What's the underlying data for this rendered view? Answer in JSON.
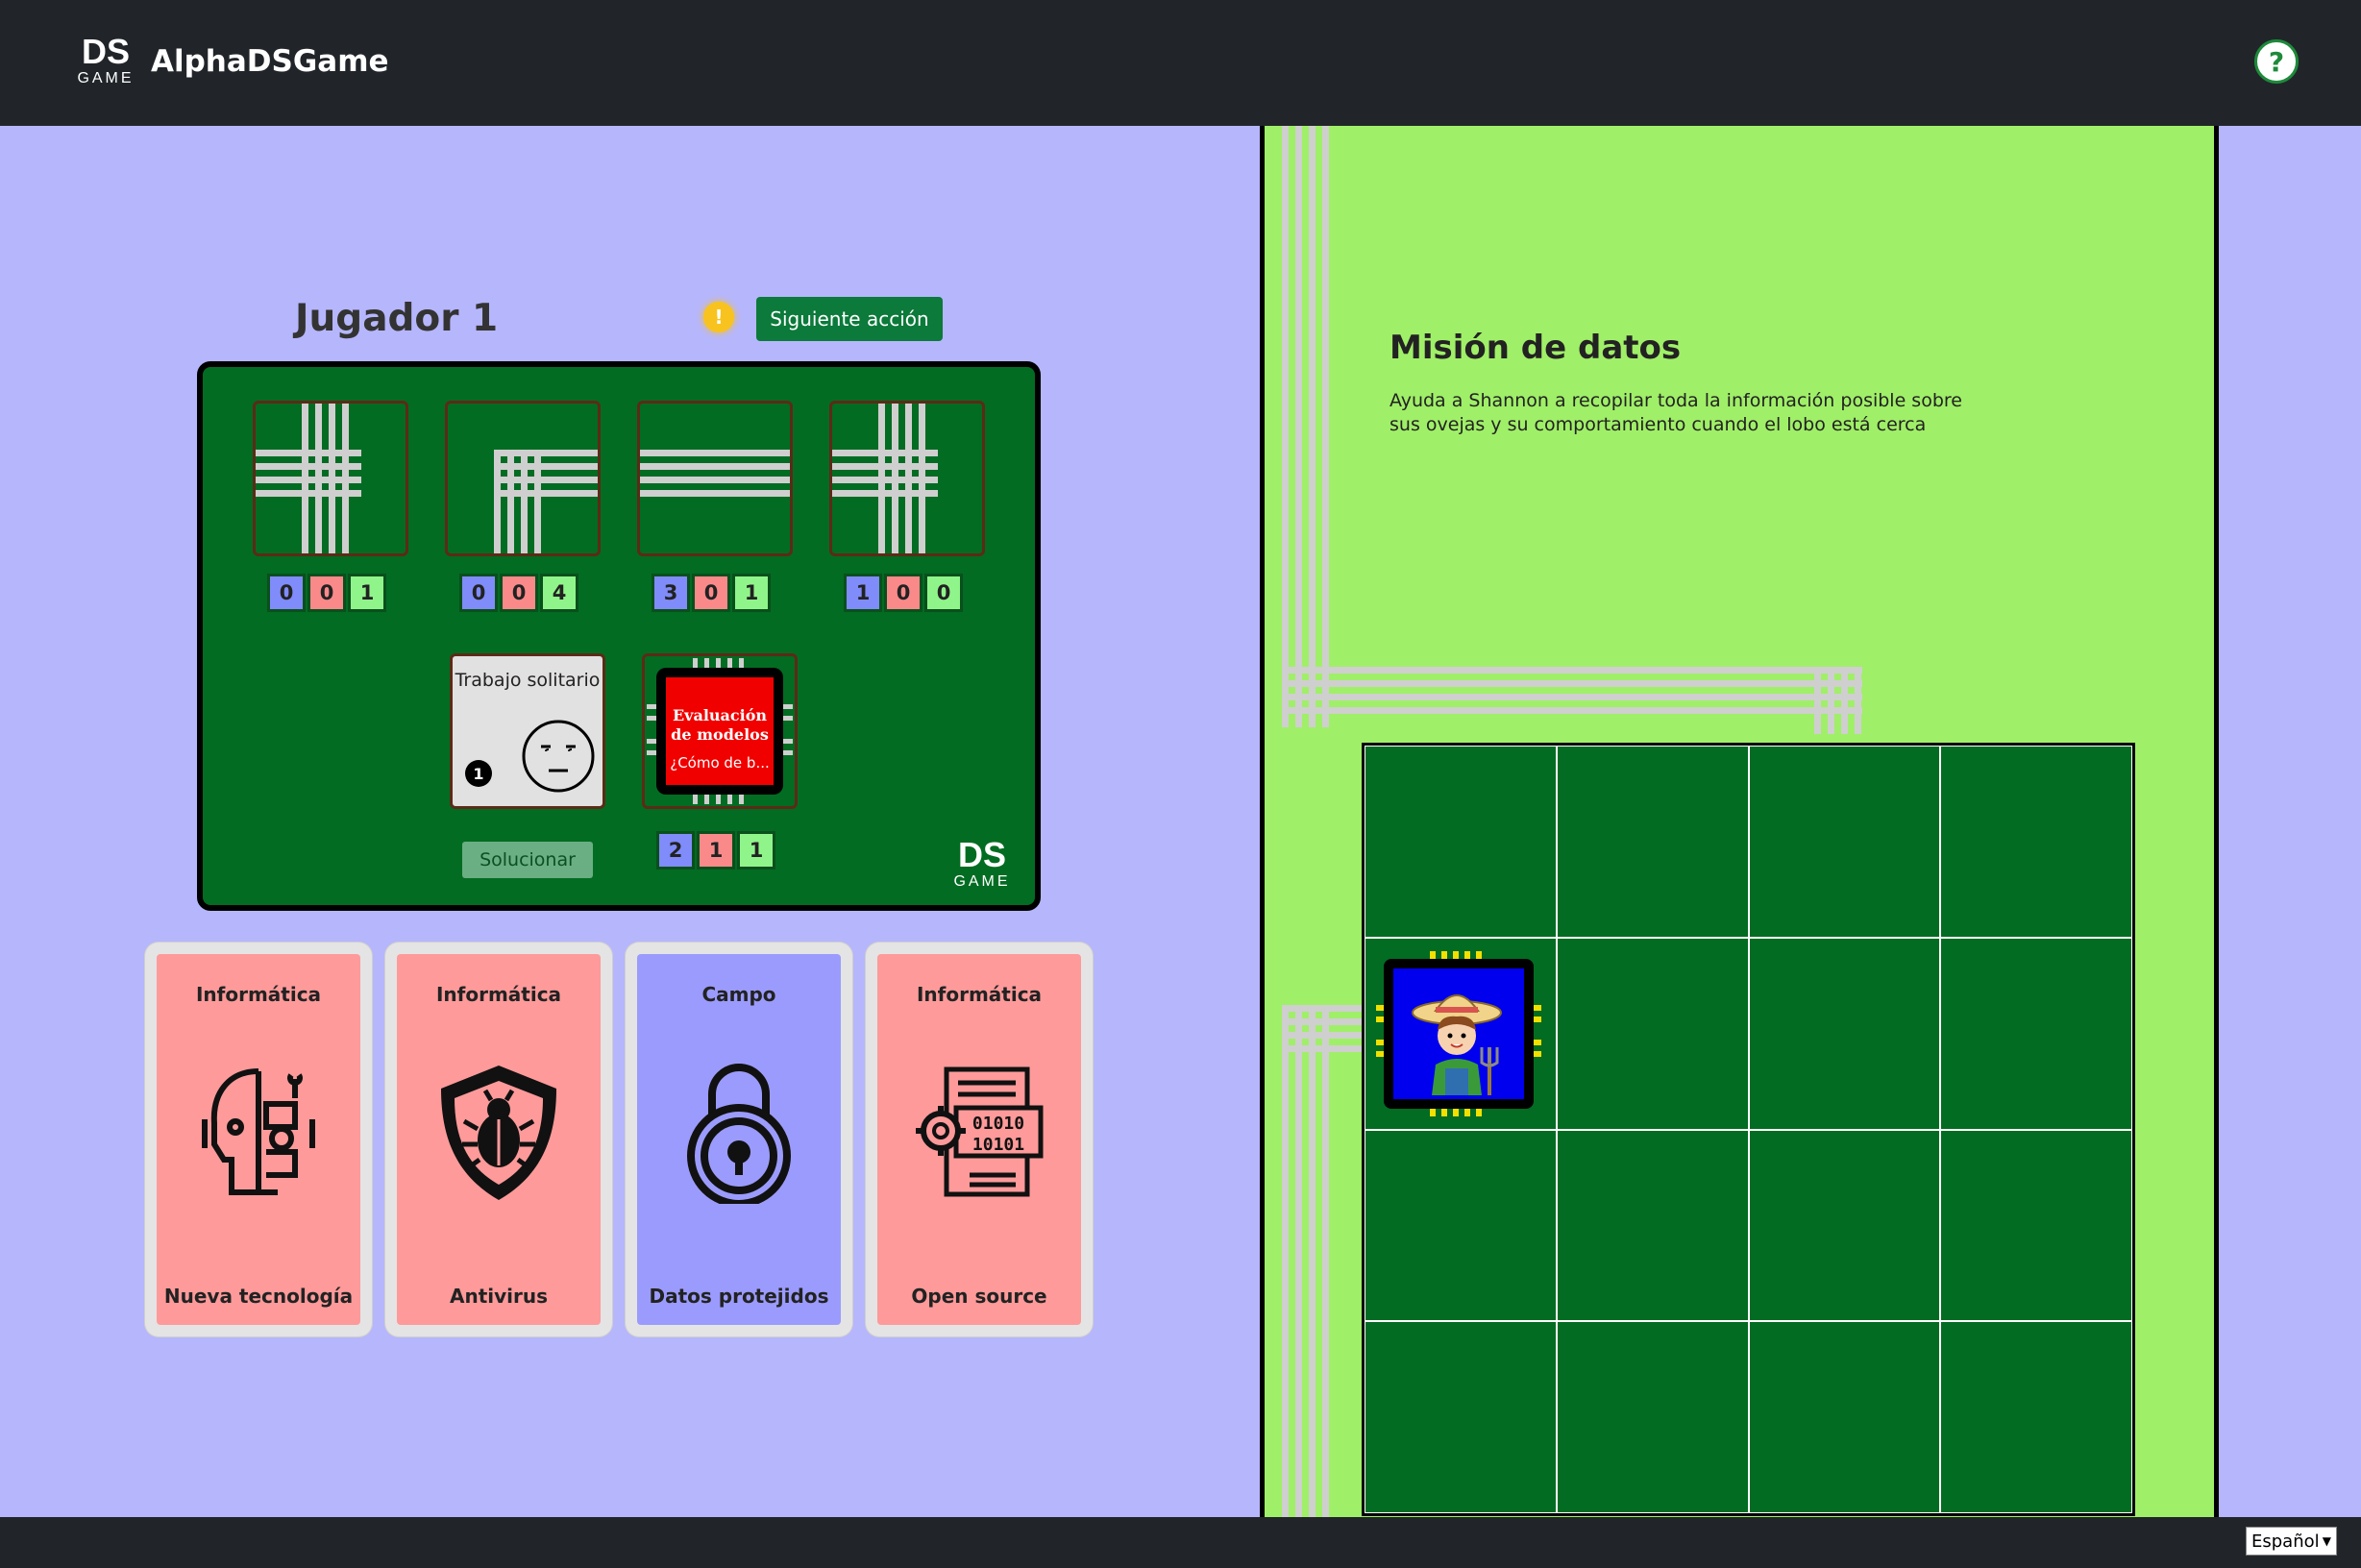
{
  "app": {
    "title": "AlphaDSGame",
    "logo_top": "DS",
    "logo_bottom": "GAME",
    "help_label": "?"
  },
  "player": {
    "name": "Jugador 1",
    "warning_icon": "!",
    "next_action_label": "Siguiente acción"
  },
  "board": {
    "tiles": [
      {
        "pattern": "cross-top-left",
        "counts": [
          0,
          0,
          1
        ]
      },
      {
        "pattern": "corner-bottom-right",
        "counts": [
          0,
          0,
          4
        ]
      },
      {
        "pattern": "horizontal",
        "counts": [
          3,
          0,
          1
        ]
      },
      {
        "pattern": "cross-top-left",
        "counts": [
          1,
          0,
          0
        ]
      }
    ],
    "solo_card": {
      "title": "Trabajo solitario",
      "badge": "1",
      "action_label": "Solucionar"
    },
    "chip_card": {
      "title_line1": "Evaluación",
      "title_line2": "de modelos",
      "subtitle": "¿Cómo de b...",
      "counts": [
        2,
        1,
        1
      ]
    }
  },
  "hand": [
    {
      "category": "Informática",
      "name": "Nueva tecnología",
      "icon": "robot-head-icon",
      "color": "#fe9a9a"
    },
    {
      "category": "Informática",
      "name": "Antivirus",
      "icon": "bug-shield-icon",
      "color": "#fe9a9a"
    },
    {
      "category": "Campo",
      "name": "Datos protejidos",
      "icon": "padlock-icon",
      "color": "#9b9bfe"
    },
    {
      "category": "Informática",
      "name": "Open source",
      "icon": "code-document-icon",
      "color": "#fe9a9a"
    }
  ],
  "mission": {
    "title": "Misión de datos",
    "description": "Ayuda a Shannon a recopilar toda la información posible sobre sus ovejas y su comportamiento cuando el lobo está cerca"
  },
  "footer": {
    "language": "Español"
  },
  "colors": {
    "nav": "#212529",
    "board": "#026c22",
    "bg": "#b6b6fd",
    "field": "#a0ef68",
    "accent": "#0b7a3a"
  }
}
